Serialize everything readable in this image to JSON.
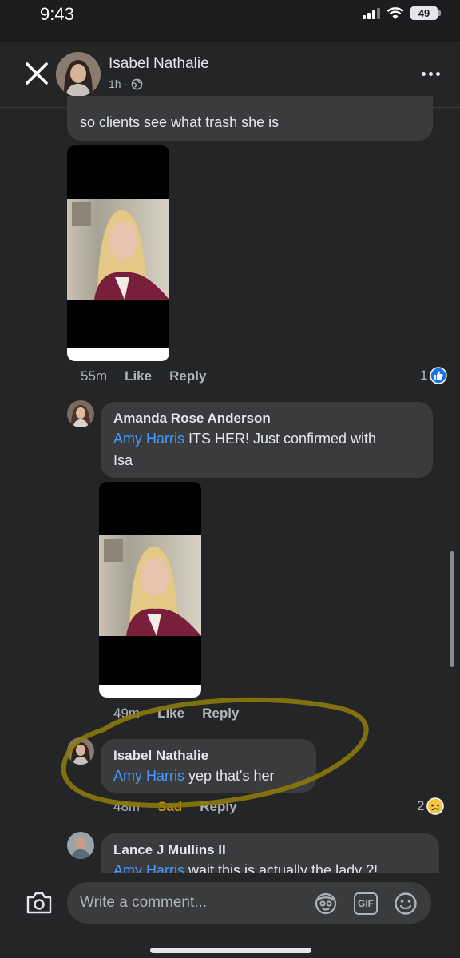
{
  "status_bar": {
    "time": "9:43",
    "battery": "49"
  },
  "header": {
    "poster_name": "Isabel Nathalie",
    "post_age": "1h ·"
  },
  "comments": [
    {
      "text": "so clients see what trash she is",
      "time": "55m",
      "like_label": "Like",
      "reply_label": "Reply",
      "reaction_count": "1",
      "reaction": "like-icon"
    },
    {
      "author": "Amanda Rose Anderson",
      "mention": "Amy Harris",
      "text_line1": " ITS HER! Just confirmed with",
      "text_line2": "Isa",
      "time": "49m",
      "like_label": "Like",
      "reply_label": "Reply"
    },
    {
      "author": "Isabel Nathalie",
      "mention": "Amy Harris",
      "text": " yep that's her",
      "time": "48m",
      "reaction_label": "Sad",
      "reply_label": "Reply",
      "reaction_count": "2",
      "reaction": "sad-icon"
    },
    {
      "author": "Lance J Mullins II",
      "mention": "Amy Harris",
      "text": " wait this is actually the lady ?!"
    }
  ],
  "composer": {
    "placeholder": "Write a comment...",
    "gif_label": "GIF"
  },
  "colors": {
    "background": "#242526",
    "bubble": "#3a3b3c",
    "mention": "#4599ff",
    "sad_reaction": "#c79312",
    "highlight_marker": "#8b7a0c"
  }
}
